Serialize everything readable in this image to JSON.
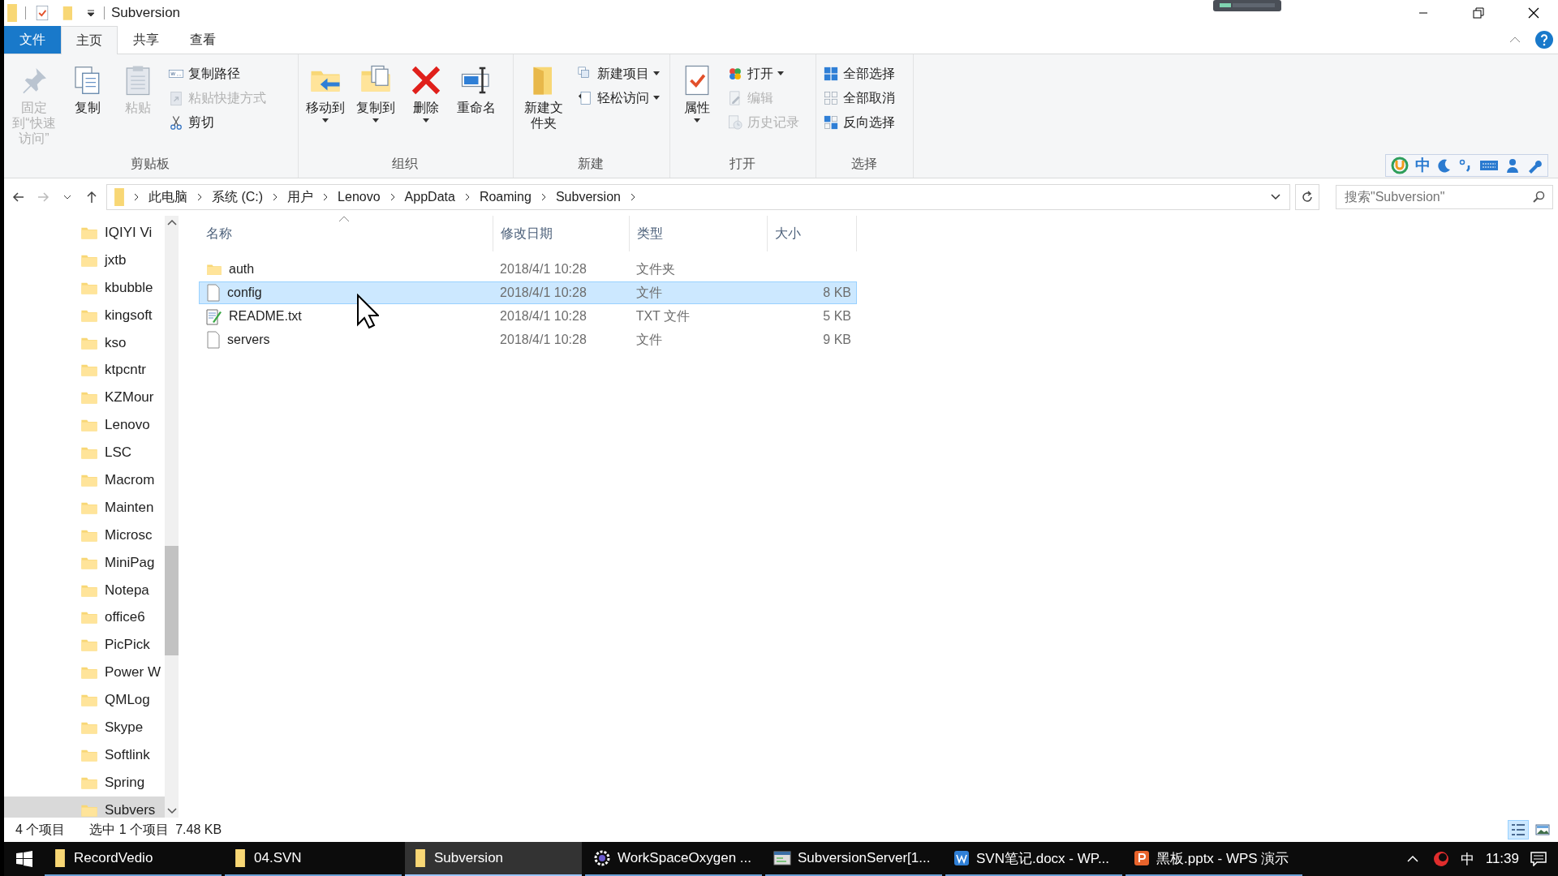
{
  "window": {
    "title": "Subversion"
  },
  "ribbon_tabs": [
    {
      "label": "文件",
      "kind": "file",
      "selected": false
    },
    {
      "label": "主页",
      "kind": "tab",
      "selected": true
    },
    {
      "label": "共享",
      "kind": "tab",
      "selected": false
    },
    {
      "label": "查看",
      "kind": "tab",
      "selected": false
    }
  ],
  "ribbon_groups": [
    {
      "label": "剪贴板",
      "items": [
        {
          "kind": "large",
          "label": "固定到“快速访问”",
          "disabled": true,
          "dropdown": false
        },
        {
          "kind": "large",
          "label": "复制",
          "disabled": false,
          "dropdown": false
        },
        {
          "kind": "large",
          "label": "粘贴",
          "disabled": true,
          "dropdown": false
        },
        {
          "kind": "small",
          "label": "复制路径",
          "disabled": false,
          "dropdown": false
        },
        {
          "kind": "small",
          "label": "粘贴快捷方式",
          "disabled": true,
          "dropdown": false
        },
        {
          "kind": "small",
          "label": "剪切",
          "disabled": false,
          "dropdown": false
        }
      ]
    },
    {
      "label": "组织",
      "items": [
        {
          "kind": "large",
          "label": "移动到",
          "disabled": false,
          "dropdown": true
        },
        {
          "kind": "large",
          "label": "复制到",
          "disabled": false,
          "dropdown": true
        },
        {
          "kind": "large",
          "label": "删除",
          "disabled": false,
          "dropdown": true
        },
        {
          "kind": "large",
          "label": "重命名",
          "disabled": false,
          "dropdown": false
        }
      ]
    },
    {
      "label": "新建",
      "items": [
        {
          "kind": "large",
          "label": "新建文件夹",
          "disabled": false,
          "dropdown": false
        },
        {
          "kind": "small",
          "label": "新建项目",
          "disabled": false,
          "dropdown": true
        },
        {
          "kind": "small",
          "label": "轻松访问",
          "disabled": false,
          "dropdown": true
        }
      ]
    },
    {
      "label": "打开",
      "items": [
        {
          "kind": "large",
          "label": "属性",
          "disabled": false,
          "dropdown": true
        },
        {
          "kind": "small",
          "label": "打开",
          "disabled": false,
          "dropdown": true
        },
        {
          "kind": "small",
          "label": "编辑",
          "disabled": true,
          "dropdown": false
        },
        {
          "kind": "small",
          "label": "历史记录",
          "disabled": true,
          "dropdown": false
        }
      ]
    },
    {
      "label": "选择",
      "items": [
        {
          "kind": "small",
          "label": "全部选择",
          "disabled": false,
          "dropdown": false
        },
        {
          "kind": "small",
          "label": "全部取消",
          "disabled": false,
          "dropdown": false
        },
        {
          "kind": "small",
          "label": "反向选择",
          "disabled": false,
          "dropdown": false
        }
      ]
    }
  ],
  "breadcrumb": [
    "此电脑",
    "系统 (C:)",
    "用户",
    "Lenovo",
    "AppData",
    "Roaming",
    "Subversion"
  ],
  "search": {
    "placeholder": "搜索\"Subversion\""
  },
  "ime_toolbar": {
    "mode": "中"
  },
  "sidebar": {
    "items": [
      {
        "label": "IQIYI Vi",
        "selected": false
      },
      {
        "label": "jxtb",
        "selected": false
      },
      {
        "label": "kbubble",
        "selected": false
      },
      {
        "label": "kingsoft",
        "selected": false
      },
      {
        "label": "kso",
        "selected": false
      },
      {
        "label": "ktpcntr",
        "selected": false
      },
      {
        "label": "KZMour",
        "selected": false
      },
      {
        "label": "Lenovo",
        "selected": false
      },
      {
        "label": "LSC",
        "selected": false
      },
      {
        "label": "Macrom",
        "selected": false
      },
      {
        "label": "Mainten",
        "selected": false
      },
      {
        "label": "Microsc",
        "selected": false
      },
      {
        "label": "MiniPag",
        "selected": false
      },
      {
        "label": "Notepa",
        "selected": false
      },
      {
        "label": "office6",
        "selected": false
      },
      {
        "label": "PicPick",
        "selected": false
      },
      {
        "label": "Power W",
        "selected": false
      },
      {
        "label": "QMLog",
        "selected": false
      },
      {
        "label": "Skype",
        "selected": false
      },
      {
        "label": "Softlink",
        "selected": false
      },
      {
        "label": "Spring",
        "selected": false
      },
      {
        "label": "Subvers",
        "selected": true
      }
    ]
  },
  "table": {
    "columns": [
      "名称",
      "修改日期",
      "类型",
      "大小"
    ],
    "rows": [
      {
        "kind": "folder",
        "name": "auth",
        "date": "2018/4/1 10:28",
        "type": "文件夹",
        "selected": false
      },
      {
        "kind": "file",
        "name": "config",
        "date": "2018/4/1 10:28",
        "type": "文件",
        "size": "8 KB",
        "selected": true
      },
      {
        "kind": "text",
        "name": "README.txt",
        "date": "2018/4/1 10:28",
        "type": "TXT 文件",
        "size": "5 KB",
        "selected": false
      },
      {
        "kind": "file",
        "name": "servers",
        "date": "2018/4/1 10:28",
        "type": "文件",
        "size": "9 KB",
        "selected": false
      }
    ]
  },
  "status_bar": {
    "item_count": "4 个项目",
    "selection": "选中 1 个项目",
    "selection_size": "7.48 KB",
    "views": [
      {
        "kind": "details",
        "selected": true
      },
      {
        "kind": "large",
        "selected": false
      }
    ]
  },
  "taskbar": {
    "items": [
      {
        "label": "RecordVedio",
        "kind": "folder",
        "selected": false
      },
      {
        "label": "04.SVN",
        "kind": "folder",
        "selected": false
      },
      {
        "label": "Subversion",
        "kind": "folder",
        "selected": true
      },
      {
        "label": "WorkSpaceOxygen ...",
        "kind": "gear",
        "selected": false
      },
      {
        "label": "SubversionServer[1...",
        "kind": "server",
        "selected": false
      },
      {
        "label": "SVN笔记.docx - WP...",
        "kind": "writer",
        "selected": false
      },
      {
        "label": "黑板.pptx - WPS 演示",
        "kind": "slides",
        "selected": false
      }
    ],
    "input_mode": "中",
    "clock": "11:39"
  }
}
